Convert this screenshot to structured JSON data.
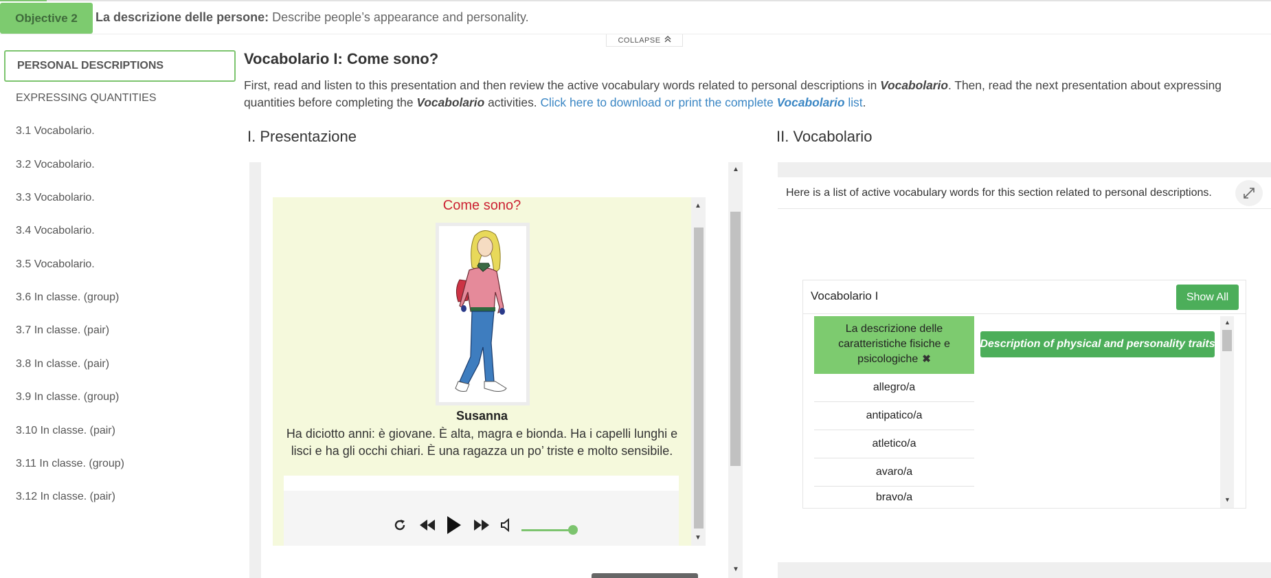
{
  "objective": {
    "badge": "Objective 2",
    "title": "La descrizione delle persone:",
    "subtitle": " Describe people’s appearance and personality."
  },
  "collapse_label": "COLLAPSE",
  "sidebar": {
    "items": [
      {
        "label": "PERSONAL DESCRIPTIONS"
      },
      {
        "label": "EXPRESSING QUANTITIES"
      },
      {
        "label": "3.1 Vocabolario."
      },
      {
        "label": "3.2 Vocabolario."
      },
      {
        "label": "3.3 Vocabolario."
      },
      {
        "label": "3.4 Vocabolario."
      },
      {
        "label": "3.5 Vocabolario."
      },
      {
        "label": "3.6 In classe. (group)"
      },
      {
        "label": "3.7 In classe. (pair)"
      },
      {
        "label": "3.8 In classe. (pair)"
      },
      {
        "label": "3.9 In classe. (group)"
      },
      {
        "label": "3.10 In classe. (pair)"
      },
      {
        "label": "3.11 In classe. (group)"
      },
      {
        "label": "3.12 In classe. (pair)"
      }
    ]
  },
  "main": {
    "title": "Vocabolario I: Come sono?",
    "intro": {
      "p1": "First, read and listen to this presentation and then review the active vocabulary words related to personal descriptions in ",
      "em1": "Vocabolario",
      "p2": ". Then, read the next presentation about expressing quantities before completing the ",
      "em2": "Vocabolario",
      "p3": " activities. ",
      "link1": "Click here to download or print the complete ",
      "link_em": "Vocabolario",
      "link2": " list",
      "end": "."
    },
    "section1": "I. Presentazione",
    "section2": "II. Vocabolario"
  },
  "presentation": {
    "title": "Come sono?",
    "name": "Susanna",
    "text": "Ha diciotto anni: è giovane. È alta, magra e bionda. Ha i capelli lunghi e lisci e ha gli occhi chiari. È una ragazza un po’ triste e molto sensibile.",
    "player": {
      "volume": 0.9,
      "icons": [
        "replay-icon",
        "rewind-icon",
        "play-icon",
        "fast-forward-icon",
        "volume-icon"
      ]
    }
  },
  "vocab": {
    "note": "Here is a list of active vocabulary words for this section related to personal descriptions.",
    "box_title": "Vocabolario I",
    "show_all": "Show All",
    "term_header": "La descrizione delle caratteristiche fisiche e psicologiche",
    "term_header_close": "✖",
    "def_header": "Description of physical and personality traits",
    "terms": [
      "allegro/a",
      "antipatico/a",
      "atletico/a",
      "avaro/a",
      "bravo/a"
    ]
  },
  "colors": {
    "accent_green": "#7dcb6f",
    "button_green": "#4cae5a",
    "link_blue": "#3a86c4",
    "title_red": "#cc2233",
    "card_bg": "#f5f9dc"
  }
}
